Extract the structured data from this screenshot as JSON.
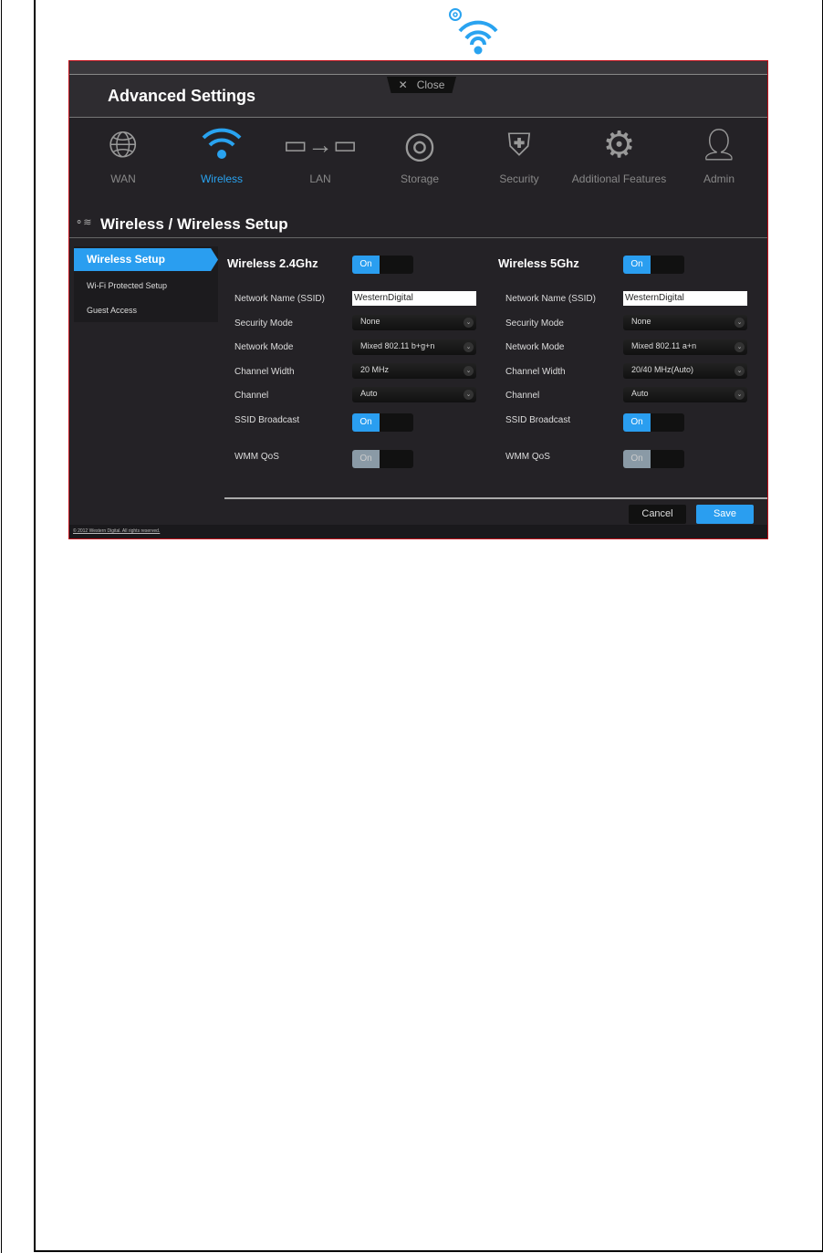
{
  "header_icon": "wifi-gear-icon",
  "app": {
    "title": "Advanced Settings",
    "close_label": "Close"
  },
  "nav": [
    {
      "label": "WAN",
      "icon": "globe-icon"
    },
    {
      "label": "Wireless",
      "icon": "wifi-icon"
    },
    {
      "label": "LAN",
      "icon": "laptops-icon"
    },
    {
      "label": "Storage",
      "icon": "disc-icon"
    },
    {
      "label": "Security",
      "icon": "shield-icon"
    },
    {
      "label": "Additional Features",
      "icon": "gears-icon"
    },
    {
      "label": "Admin",
      "icon": "user-icon"
    }
  ],
  "breadcrumb": "Wireless / Wireless Setup",
  "sidebar": [
    "Wireless Setup",
    "Wi-Fi Protected Setup",
    "Guest Access"
  ],
  "labels": {
    "ssid": "Network Name (SSID)",
    "security": "Security Mode",
    "mode": "Network Mode",
    "width": "Channel Width",
    "channel": "Channel",
    "broadcast": "SSID Broadcast",
    "wmm": "WMM QoS",
    "on": "On"
  },
  "band24": {
    "title": "Wireless 2.4Ghz",
    "ssid": "WesternDigital",
    "security": "None",
    "mode": "Mixed 802.11 b+g+n",
    "width": "20 MHz",
    "channel": "Auto"
  },
  "band5": {
    "title": "Wireless 5Ghz",
    "ssid": "WesternDigital",
    "security": "None",
    "mode": "Mixed 802.11 a+n",
    "width": "20/40 MHz(Auto)",
    "channel": "Auto"
  },
  "buttons": {
    "cancel": "Cancel",
    "save": "Save"
  },
  "footer": "© 2012 Western Digital. All rights reserved."
}
